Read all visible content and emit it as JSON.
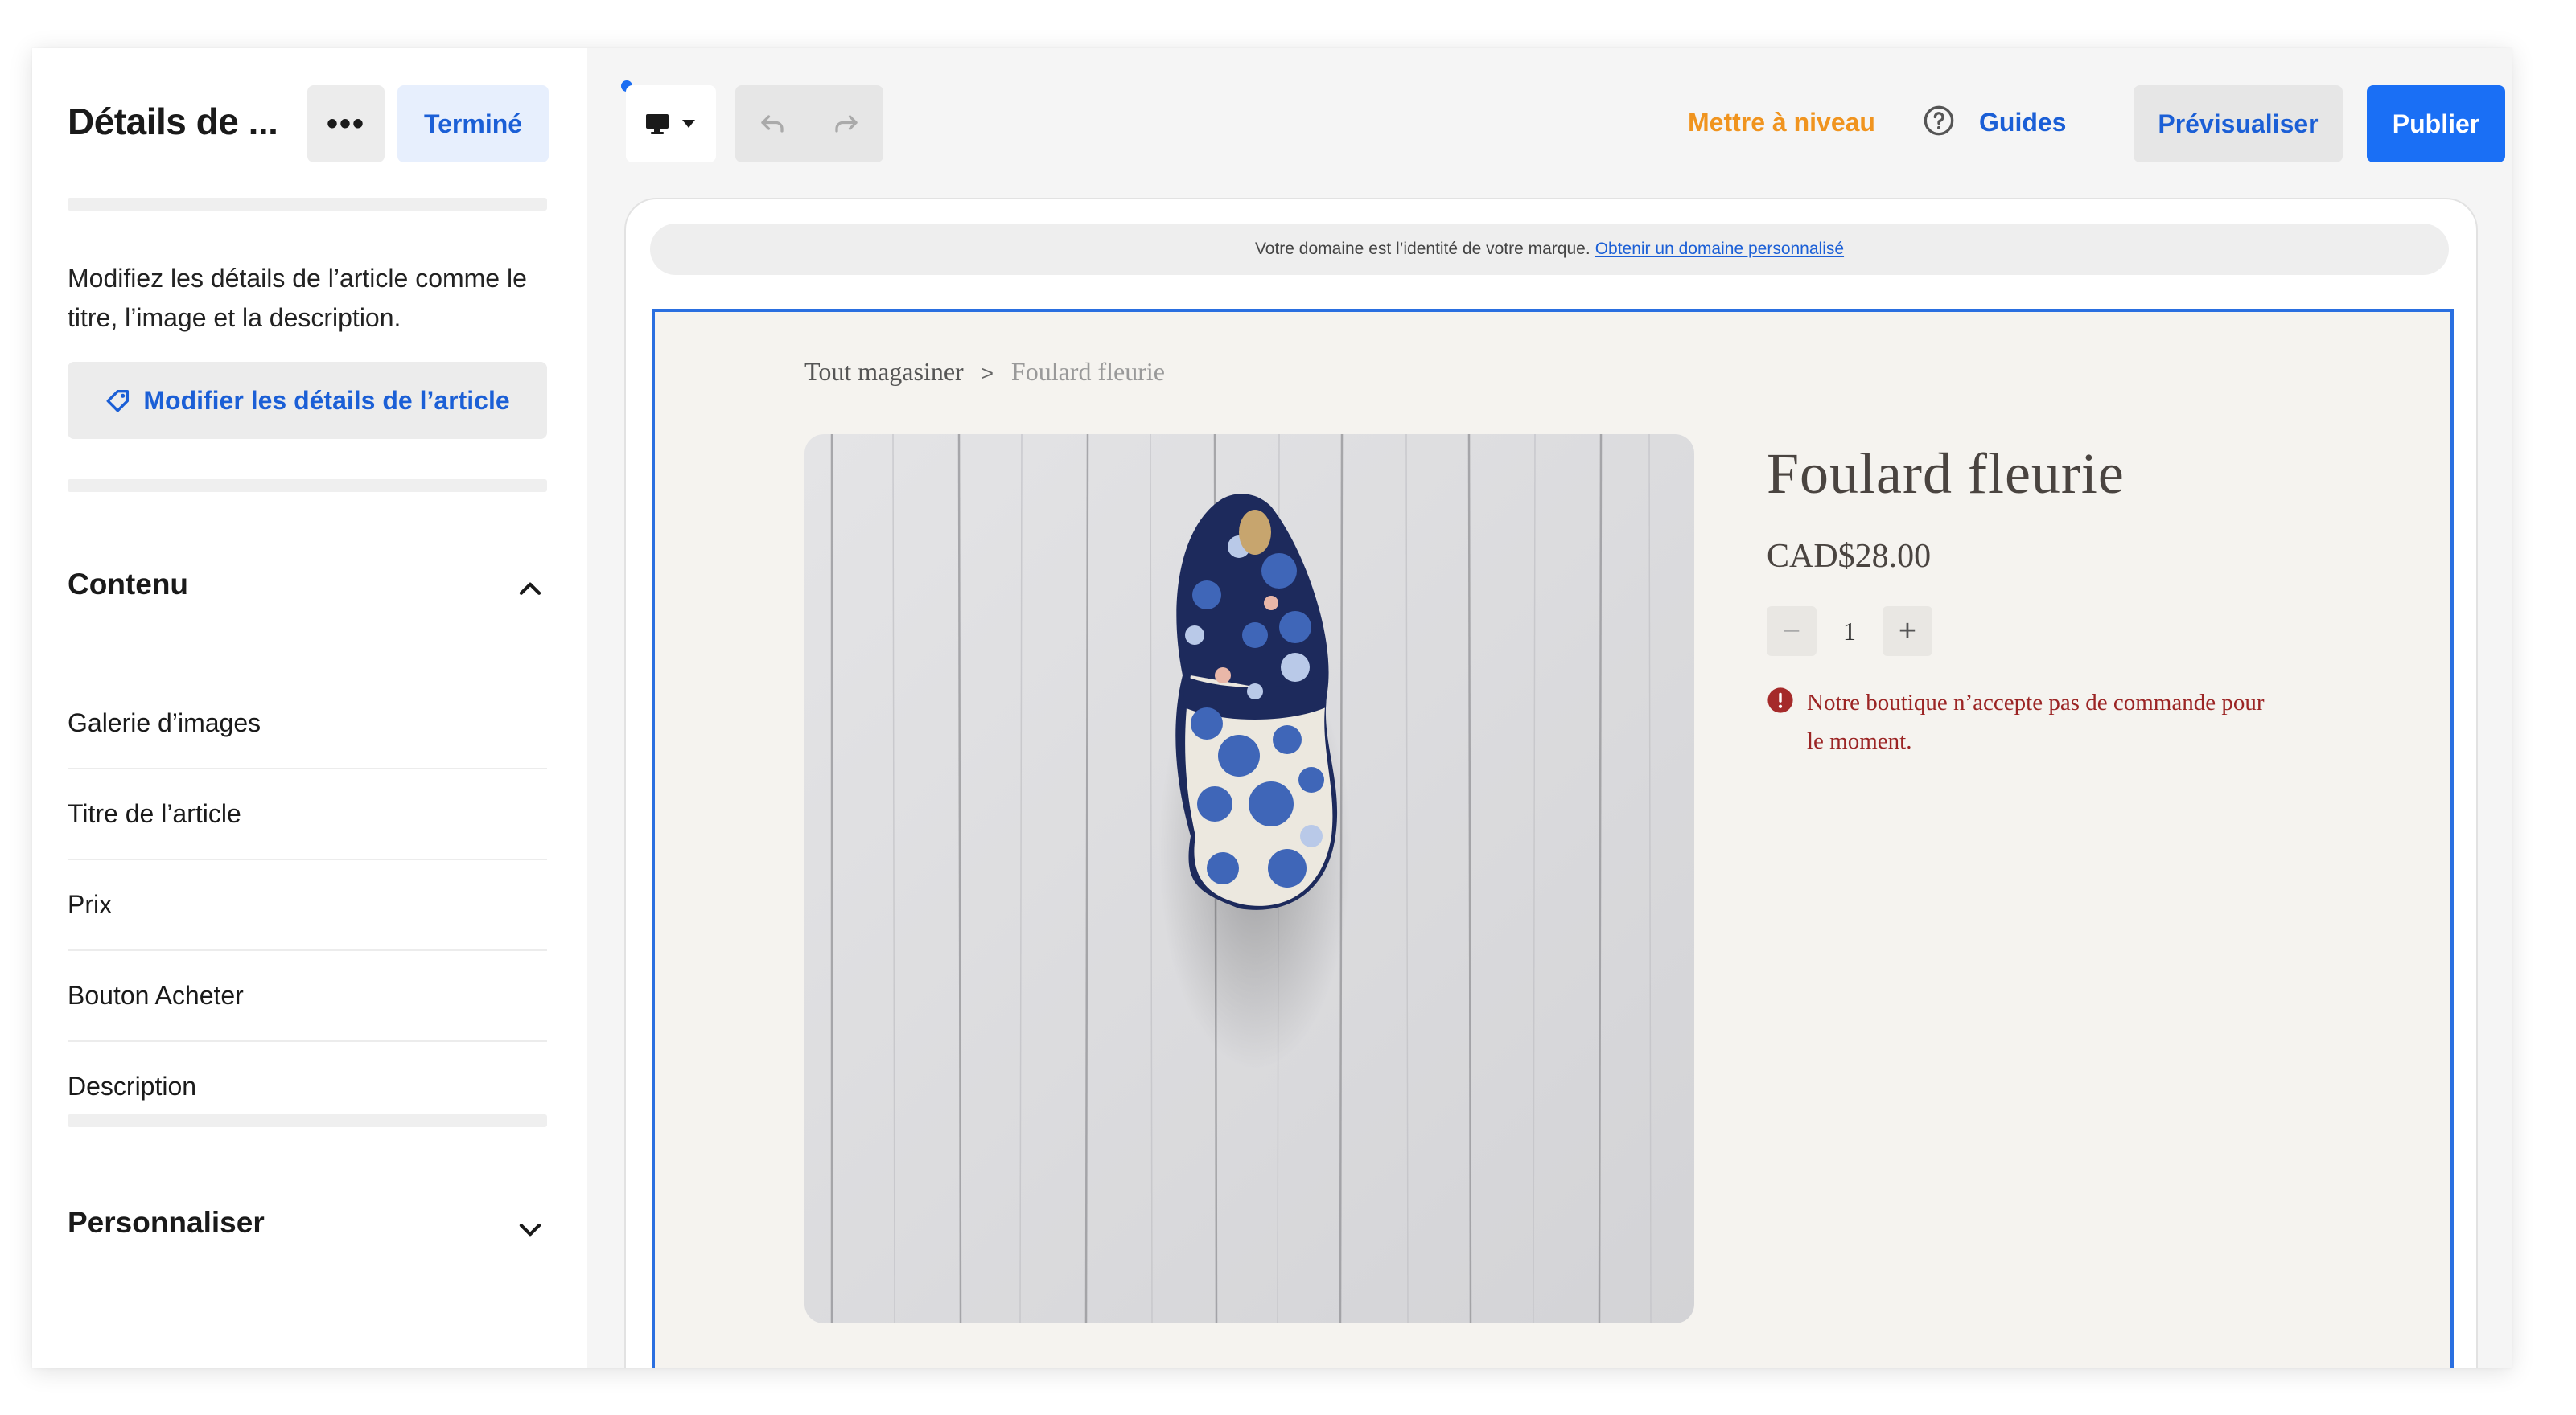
{
  "sidebar": {
    "title": "Détails de ...",
    "more_label": "•••",
    "done_label": "Terminé",
    "description": "Modifiez les détails de l’article comme le titre, l’image et la description.",
    "edit_details_label": "Modifier les détails de l’article",
    "content_section": {
      "title": "Contenu",
      "expanded": true,
      "items": [
        {
          "label": "Galerie d’images"
        },
        {
          "label": "Titre de l’article"
        },
        {
          "label": "Prix"
        },
        {
          "label": "Bouton Acheter"
        },
        {
          "label": "Description"
        }
      ]
    },
    "customize_section": {
      "title": "Personnaliser",
      "expanded": false
    }
  },
  "toolbar": {
    "device_icon": "desktop-icon",
    "upgrade_label": "Mettre à niveau",
    "guides_label": "Guides",
    "preview_label": "Prévisualiser",
    "publish_label": "Publier"
  },
  "canvas": {
    "domain_banner": {
      "text": "Votre domaine est l’identité de votre marque.",
      "link_text": "Obtenir un domaine personnalisé"
    },
    "breadcrumb": {
      "root": "Tout magasiner",
      "separator": ">",
      "current": "Foulard fleurie"
    },
    "product": {
      "title": "Foulard fleurie",
      "price": "CAD$28.00",
      "quantity": "1",
      "minus_label": "−",
      "plus_label": "+",
      "error_message": "Notre boutique n’accepte pas de commande pour le moment."
    }
  },
  "colors": {
    "accent_blue": "#1a6ff5",
    "link_blue": "#1b5fd6",
    "upgrade_orange": "#f0941f",
    "error_red": "#9b2424",
    "store_background": "#f5f3ef"
  }
}
